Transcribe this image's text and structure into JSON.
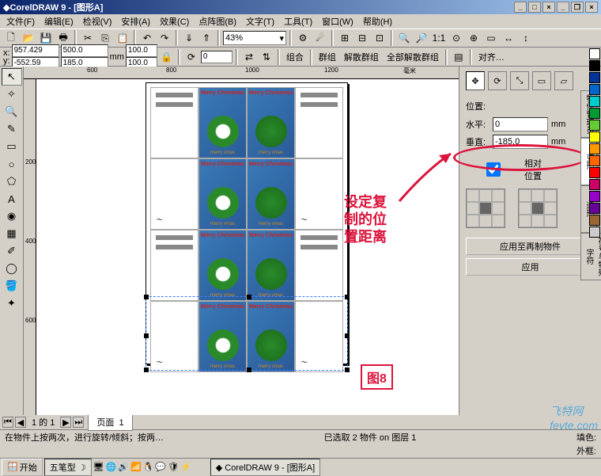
{
  "title": "CorelDRAW 9 - [图形A]",
  "menus": [
    "文件(F)",
    "编辑(E)",
    "检视(V)",
    "安排(A)",
    "效果(C)",
    "点阵图(B)",
    "文字(T)",
    "工具(T)",
    "窗口(W)",
    "帮助(H)"
  ],
  "zoom": "43%",
  "coords": {
    "x_label": "x:",
    "y_label": "y:",
    "x": "957.429",
    "y": "-552.59",
    "w": "500.0",
    "h": "185.0",
    "unit": "mm",
    "sx": "100.0",
    "sy": "100.0"
  },
  "propbar": {
    "combine": "组合",
    "group": "群组",
    "ungroup": "解散群组",
    "ungroup_all": "全部解散群组",
    "align": "对齐…"
  },
  "ruler_h": [
    "600",
    "800",
    "1000",
    "1200",
    "毫米"
  ],
  "ruler_v": [
    "200",
    "400",
    "600"
  ],
  "card": {
    "title": "Merry Christmas",
    "subtitle": "merry xmas"
  },
  "docker": {
    "pos_label": "位置:",
    "h_label": "水平:",
    "v_label": "垂直:",
    "h_val": "0",
    "v_val": "-185.0",
    "unit": "mm",
    "rel_label": "相对位置",
    "apply_dup": "应用至再制物件",
    "apply": "应用"
  },
  "docker_tabs": [
    "物件管理员",
    "变形",
    "造形",
    "符号与特殊字符"
  ],
  "annotation": "设定复\n制的位\n置距离",
  "figure_label": "图8",
  "tabbar": {
    "page_count": "1 的 1",
    "page_label": "页面",
    "page_num": "1"
  },
  "status_hint": "在物件上按两次，进行旋转/倾斜；按两…",
  "status_sel": "已选取 2 物件 on 图层 1",
  "status_fill": "填色:",
  "status_outline": "外框:",
  "taskbar": {
    "start": "开始",
    "ime": "五笔型",
    "app": "CorelDRAW 9 - [图形A]"
  },
  "watermark": "飞特网\nfevte.com",
  "palette": [
    "#ffffff",
    "#000000",
    "#003399",
    "#0066cc",
    "#00cccc",
    "#009933",
    "#66cc33",
    "#ffff00",
    "#ff9900",
    "#ff6600",
    "#ff0000",
    "#cc0066",
    "#9900cc",
    "#660099",
    "#996633",
    "#cccccc"
  ]
}
